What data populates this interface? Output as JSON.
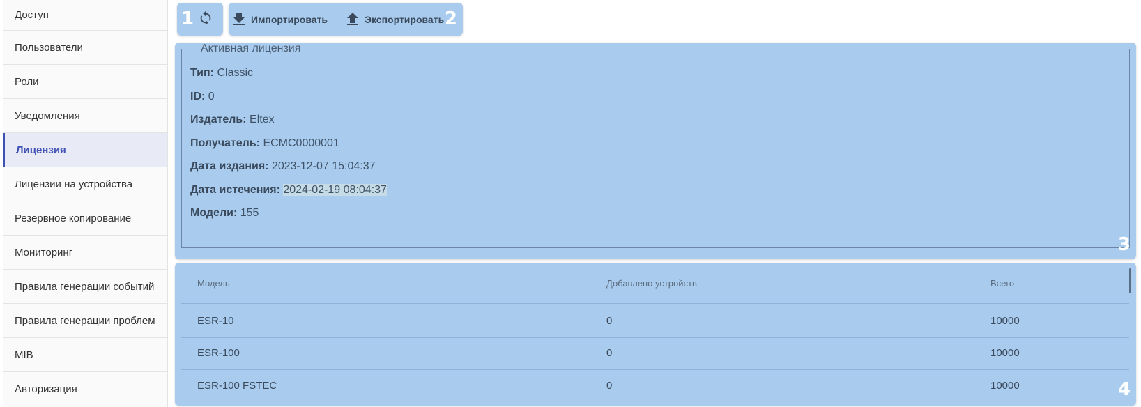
{
  "sidebar": {
    "items": [
      {
        "label": "Доступ"
      },
      {
        "label": "Пользователи"
      },
      {
        "label": "Роли"
      },
      {
        "label": "Уведомления"
      },
      {
        "label": "Лицензия"
      },
      {
        "label": "Лицензии на устройства"
      },
      {
        "label": "Резервное копирование"
      },
      {
        "label": "Мониторинг"
      },
      {
        "label": "Правила генерации событий"
      },
      {
        "label": "Правила генерации проблем"
      },
      {
        "label": "MIB"
      },
      {
        "label": "Авторизация"
      }
    ],
    "active": "Лицензия"
  },
  "markers": {
    "m1": "1",
    "m2": "2",
    "m3": "3",
    "m4": "4"
  },
  "toolbar": {
    "refresh_icon": "refresh-icon",
    "import_label": "Импортировать",
    "import_icon": "download-icon",
    "export_label": "Экспортировать",
    "export_icon": "upload-icon"
  },
  "license": {
    "legend": "Активная лицензия",
    "type_label": "Тип:",
    "type_value": "Classic",
    "id_label": "ID:",
    "id_value": "0",
    "issuer_label": "Издатель:",
    "issuer_value": "Eltex",
    "recipient_label": "Получатель:",
    "recipient_value": "ECMC0000001",
    "issued_label": "Дата издания:",
    "issued_value": "2023-12-07 15:04:37",
    "expires_label": "Дата истечения:",
    "expires_value": "2024-02-19 08:04:37",
    "models_label": "Модели:",
    "models_value": "155"
  },
  "table": {
    "columns": [
      "Модель",
      "Добавлено устройств",
      "Всего"
    ],
    "rows": [
      [
        "ESR-10",
        "0",
        "10000"
      ],
      [
        "ESR-100",
        "0",
        "10000"
      ],
      [
        "ESR-100 FSTEC",
        "0",
        "10000"
      ]
    ]
  },
  "colors": {
    "highlight": "#a9ccee",
    "accent": "#3f51b5",
    "marker_text": "#ffffff"
  }
}
